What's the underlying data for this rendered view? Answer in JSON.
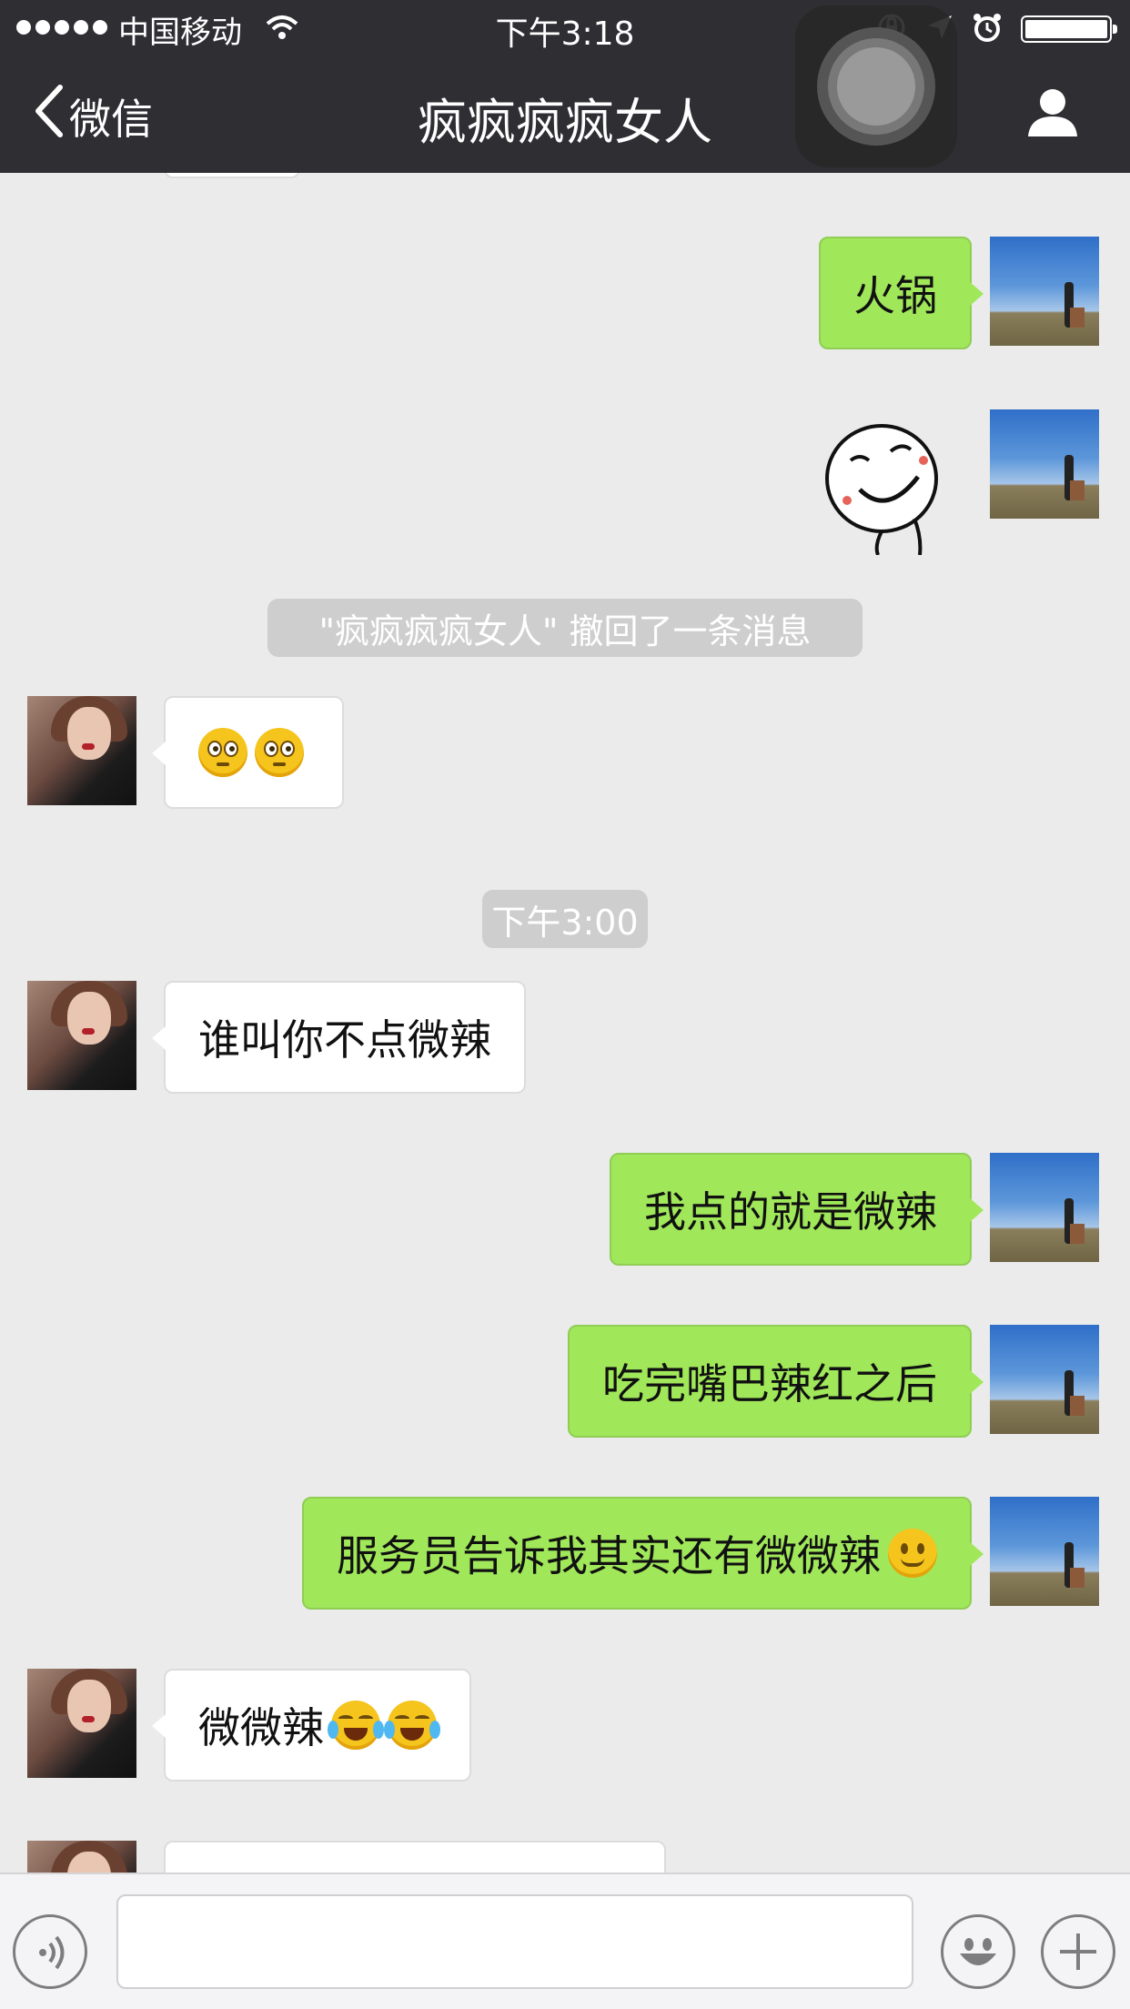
{
  "status_bar": {
    "carrier": "中国移动",
    "time": "下午3:18"
  },
  "nav": {
    "back_label": "微信",
    "title": "疯疯疯疯女人"
  },
  "messages": [
    {
      "type": "sent_text",
      "text": "火锅"
    },
    {
      "type": "sent_sticker"
    },
    {
      "type": "system",
      "text": "\"疯疯疯疯女人\" 撤回了一条消息"
    },
    {
      "type": "received_emoji",
      "emojis": [
        "flushed-face",
        "flushed-face"
      ]
    },
    {
      "type": "timestamp",
      "text": "下午3:00"
    },
    {
      "type": "received_text",
      "text": "谁叫你不点微辣"
    },
    {
      "type": "sent_text",
      "text": "我点的就是微辣"
    },
    {
      "type": "sent_text",
      "text": "吃完嘴巴辣红之后"
    },
    {
      "type": "sent_text",
      "text": "服务员告诉我其实还有微微辣",
      "emoji": "smiling-face"
    },
    {
      "type": "received_text",
      "text": "微微辣",
      "emojis": [
        "tears-of-joy-face",
        "tears-of-joy-face"
      ]
    }
  ],
  "input_bar": {
    "text_value": "",
    "icons": [
      "voice-icon",
      "emoji-icon",
      "plus-icon"
    ]
  }
}
